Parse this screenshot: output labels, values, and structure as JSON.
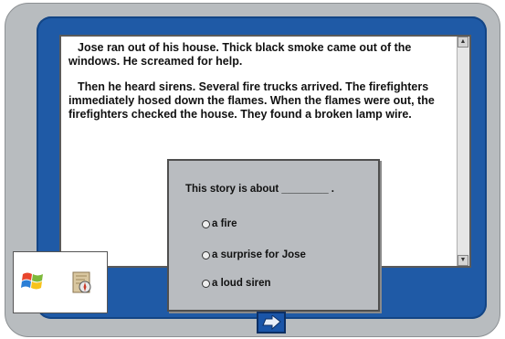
{
  "story": {
    "paragraphs": [
      "Jose ran out of his house.  Thick black smoke came out of the windows.  He screamed for help.",
      "Then he heard sirens.  Several fire trucks arrived.  The firefighters immediately hosed down the flames.  When the flames were out, the firefighters checked the house.  They found a broken lamp wire."
    ]
  },
  "quiz": {
    "question": "This story is about ________ .",
    "options": [
      "a fire",
      "a surprise for Jose",
      "a loud siren"
    ]
  },
  "nav": {
    "next_icon": "arrow-right-icon"
  },
  "taskbar": {
    "icons": [
      "windows-logo-icon",
      "map-compass-icon"
    ]
  },
  "colors": {
    "screen_blue": "#1f5aa6",
    "frame_gray": "#b8bcbf",
    "dialog_gray": "#b9bcc0"
  }
}
